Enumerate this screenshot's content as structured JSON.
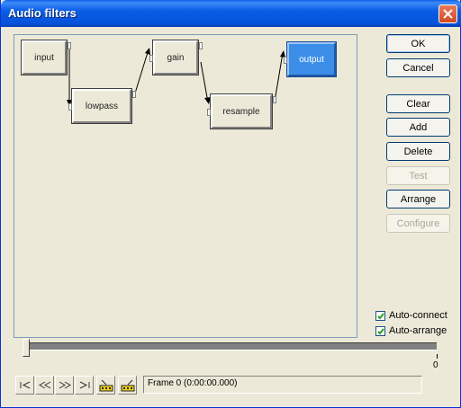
{
  "window": {
    "title": "Audio filters"
  },
  "graph": {
    "nodes": [
      {
        "id": "input",
        "label": "input"
      },
      {
        "id": "lowpass",
        "label": "lowpass"
      },
      {
        "id": "gain",
        "label": "gain"
      },
      {
        "id": "resample",
        "label": "resample"
      },
      {
        "id": "output",
        "label": "output",
        "selected": true
      }
    ]
  },
  "buttons": {
    "ok": "OK",
    "cancel": "Cancel",
    "clear": "Clear",
    "add": "Add",
    "delete": "Delete",
    "test": "Test",
    "arrange": "Arrange",
    "configure": "Configure"
  },
  "options": {
    "auto_connect": {
      "label": "Auto-connect",
      "checked": true
    },
    "auto_arrange": {
      "label": "Auto-arrange",
      "checked": true
    }
  },
  "timeline": {
    "tick_label": "0",
    "position": 0
  },
  "transport": {
    "icons": [
      "skip-start-icon",
      "step-back-icon",
      "step-forward-icon",
      "skip-end-icon",
      "mark-in-icon",
      "mark-out-icon"
    ]
  },
  "status": {
    "frame": "Frame 0 (0:00:00.000)"
  },
  "colors": {
    "title_bar": "#0553dc",
    "selected_node": "#3c8ee9",
    "close_button": "#d14a22"
  }
}
